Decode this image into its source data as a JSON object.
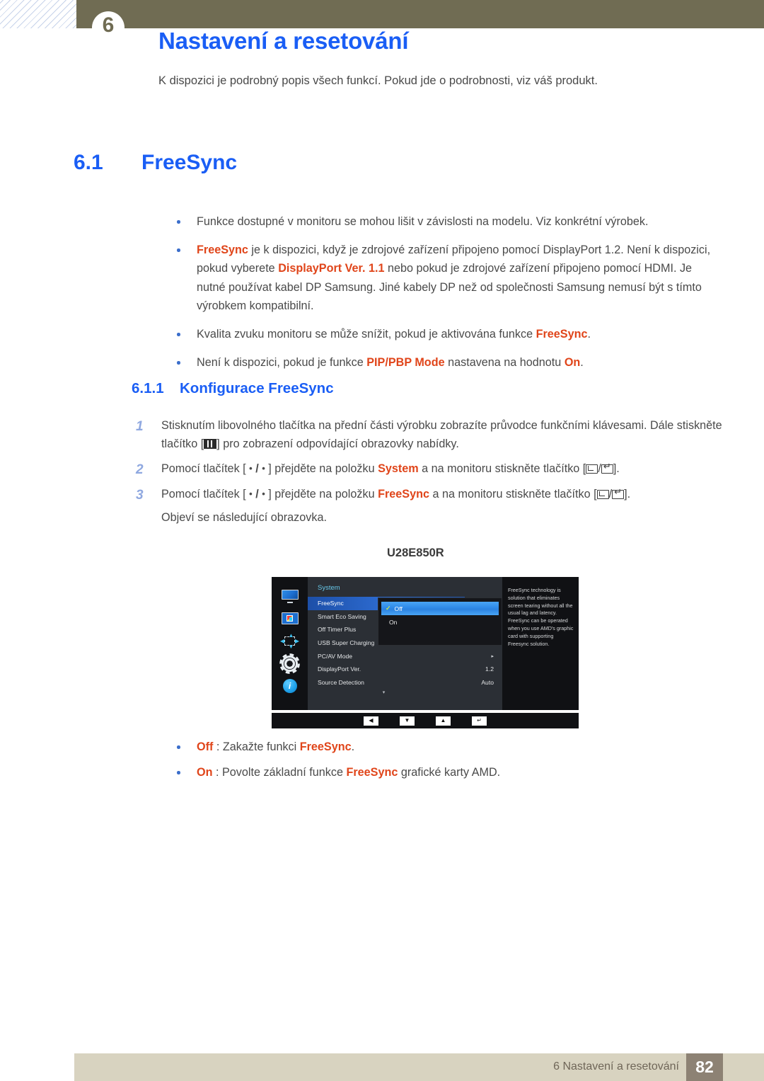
{
  "header": {
    "chapter_badge": "6",
    "title": "Nastavení a resetování",
    "intro": "K dispozici je podrobný popis všech funkcí. Pokud jde o podrobnosti, viz váš produkt."
  },
  "section": {
    "number": "6.1",
    "title": "FreeSync"
  },
  "notes": {
    "b1_t1": "Funkce dostupné v monitoru se mohou lišit v závislosti na modelu. Viz konkrétní výrobek.",
    "b2_hl1": "FreeSync",
    "b2_t1": " je k dispozici, když je zdrojové zařízení připojeno pomocí DisplayPort 1.2. Není k dispozici, pokud vyberete ",
    "b2_hl2": "DisplayPort Ver. 1.1",
    "b2_t2": " nebo pokud je zdrojové zařízení připojeno pomocí HDMI. Je nutné používat kabel DP Samsung. Jiné kabely DP než od společnosti Samsung nemusí být s tímto výrobkem kompatibilní.",
    "b3_t1": "Kvalita zvuku monitoru se může snížit, pokud je aktivována funkce ",
    "b3_hl1": "FreeSync",
    "b3_t2": ".",
    "b4_t1": "Není k dispozici, pokud je funkce ",
    "b4_hl1": "PIP/PBP Mode",
    "b4_t2": " nastavena na hodnotu ",
    "b4_hl2": "On",
    "b4_t3": "."
  },
  "subsection": {
    "number": "6.1.1",
    "title": "Konfigurace FreeSync"
  },
  "steps": {
    "s1_num": "1",
    "s1_t1": "Stisknutím libovolného tlačítka na přední části výrobku zobrazíte průvodce funkčními klávesami. Dále stiskněte tlačítko [",
    "s1_t2": "] pro zobrazení odpovídající obrazovky nabídky.",
    "s2_num": "2",
    "s2_t1": "Pomocí tlačítek [ ",
    "s2_dot1": "•",
    "s2_sep": " / ",
    "s2_dot2": "•",
    "s2_t2": " ] přejděte na položku ",
    "s2_hl": "System",
    "s2_t3": " a na monitoru stiskněte tlačítko [",
    "s2_t4": "/",
    "s2_t5": "].",
    "s3_num": "3",
    "s3_t1": "Pomocí tlačítek [ ",
    "s3_dot1": "•",
    "s3_sep": " / ",
    "s3_dot2": "•",
    "s3_t2": " ] přejděte na položku ",
    "s3_hl": "FreeSync",
    "s3_t3": " a na monitoru stiskněte tlačítko [",
    "s3_t4": "/",
    "s3_t5": "].",
    "s3_follow": "Objeví se následující obrazovka."
  },
  "osd": {
    "model": "U28E850R",
    "category": "System",
    "icons": [
      "display-icon",
      "picture-icon",
      "pip-icon",
      "system-gear-icon",
      "information-icon"
    ],
    "rows": [
      {
        "label": "FreeSync",
        "value": "",
        "arrow": "",
        "selected": true
      },
      {
        "label": "Smart Eco Saving",
        "value": "",
        "arrow": "",
        "selected": false
      },
      {
        "label": "Off Timer Plus",
        "value": "",
        "arrow": "",
        "selected": false
      },
      {
        "label": "USB Super Charging",
        "value": "",
        "arrow": "▸",
        "selected": false
      },
      {
        "label": "PC/AV Mode",
        "value": "",
        "arrow": "▸",
        "selected": false
      },
      {
        "label": "DisplayPort Ver.",
        "value": "1.2",
        "arrow": "",
        "selected": false
      },
      {
        "label": "Source Detection",
        "value": "Auto",
        "arrow": "",
        "selected": false
      }
    ],
    "scroll_indicator": "▾",
    "submenu": [
      {
        "label": "Off",
        "checked": true,
        "selected": true
      },
      {
        "label": "On",
        "checked": false,
        "selected": false
      }
    ],
    "check_glyph": "✓",
    "help_text": "FreeSync technology is solution that eliminates screen tearing without all the usual lag and latency. FreeSync can be operated when you use AMD's graphic card with supporting Freesync solution.",
    "buttons": [
      {
        "name": "back-button",
        "glyph": "◀"
      },
      {
        "name": "down-button",
        "glyph": "▼"
      },
      {
        "name": "up-button",
        "glyph": "▲"
      },
      {
        "name": "enter-button",
        "glyph": "↵"
      }
    ]
  },
  "options": {
    "o1_hl": "Off",
    "o1_t1": " : Zakažte funkci ",
    "o1_hl2": "FreeSync",
    "o1_t2": ".",
    "o2_hl": "On",
    "o2_t1": " : Povolte základní funkce ",
    "o2_hl2": "FreeSync",
    "o2_t2": " grafické karty AMD."
  },
  "footer": {
    "text": "6 Nastavení a resetování",
    "page": "82"
  },
  "colors": {
    "heading_blue": "#1a5ef5",
    "highlight_orange": "#e0451a",
    "header_band": "#706c53",
    "footer_band": "#d8d3c0",
    "footer_page_box": "#8d8274",
    "osd_selected_blue": "#2f6fd6",
    "osd_category_cyan": "#67c7e8"
  }
}
